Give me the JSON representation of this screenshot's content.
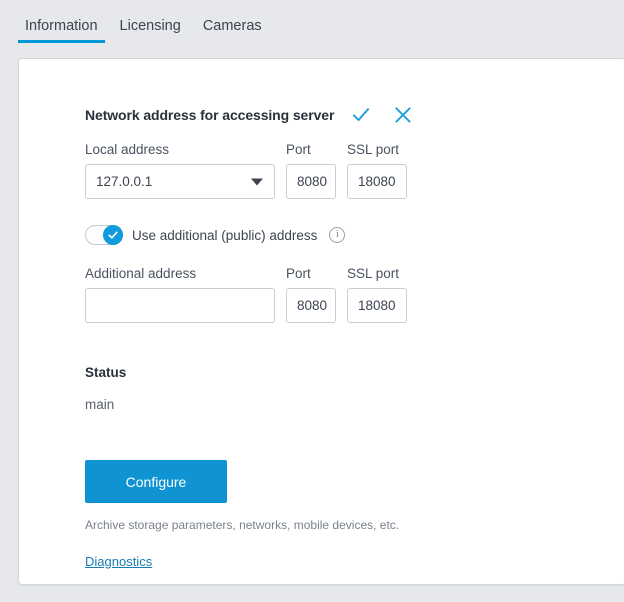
{
  "tabs": [
    {
      "label": "Information",
      "active": true
    },
    {
      "label": "Licensing",
      "active": false
    },
    {
      "label": "Cameras",
      "active": false
    }
  ],
  "panel": {
    "section_title": "Network address for accessing server",
    "confirm_icon": "check-icon",
    "cancel_icon": "close-icon",
    "local": {
      "label": "Local address",
      "value": "127.0.0.1",
      "port_label": "Port",
      "port_value": "8080",
      "ssl_label": "SSL port",
      "ssl_value": "18080"
    },
    "toggle": {
      "label": "Use additional (public) address",
      "state": "on",
      "info_icon": "info-icon",
      "info_glyph": "i"
    },
    "additional": {
      "label": "Additional address",
      "value": "",
      "placeholder": "",
      "port_label": "Port",
      "port_value": "8080",
      "ssl_label": "SSL port",
      "ssl_value": "18080"
    },
    "status": {
      "title": "Status",
      "value": "main"
    },
    "configure_button": "Configure",
    "hint": "Archive storage parameters, networks, mobile devices, etc.",
    "diagnostics_link": "Diagnostics"
  },
  "colors": {
    "accent": "#0097d7",
    "button": "#0f93d2",
    "toggle_on": "#0f9bdc",
    "link": "#1b7bb5",
    "page_bg": "#e6e8eb",
    "card_bg": "#ffffff"
  }
}
